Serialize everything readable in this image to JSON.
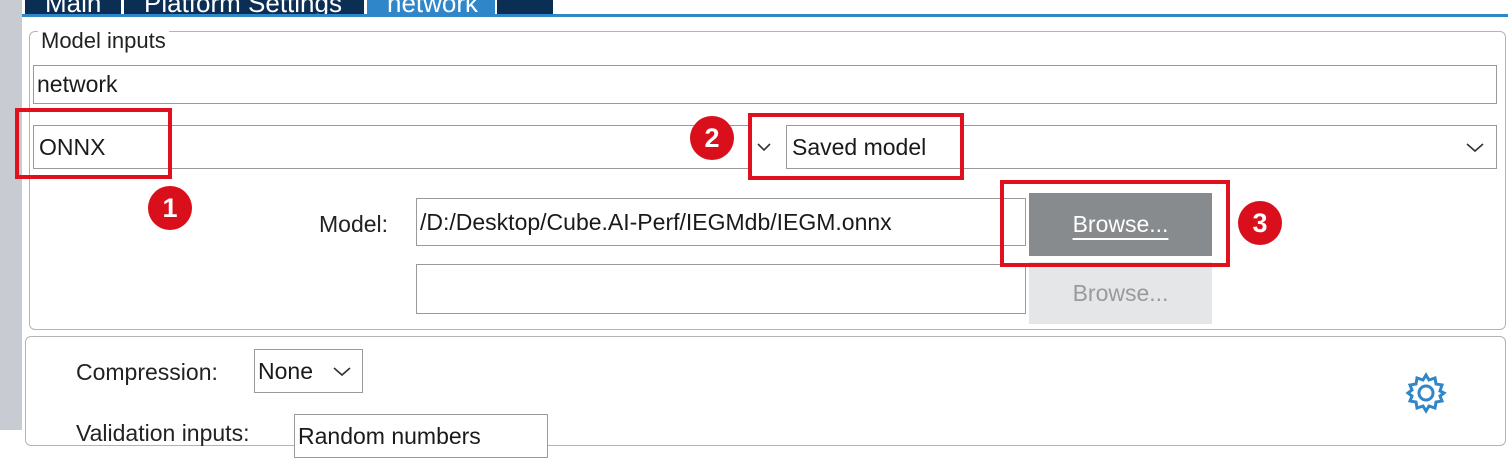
{
  "tabs": [
    {
      "label": "Main"
    },
    {
      "label": "Platform Settings"
    },
    {
      "label": "network"
    }
  ],
  "model_inputs": {
    "legend": "Model inputs",
    "name_value": "network",
    "framework_value": "ONNX",
    "model_type_value": "Saved model",
    "model_label": "Model:",
    "model_path": "/D:/Desktop/Cube.AI-Perf/IEGMdb/IEGM.onnx",
    "second_path": "",
    "browse_label": "Browse...",
    "browse_label_disabled": "Browse..."
  },
  "annotations": {
    "badge1": "1",
    "badge2": "2",
    "badge3": "3",
    "accent": "#e0101c"
  },
  "settings": {
    "compression_label": "Compression:",
    "compression_value": "None",
    "validation_label": "Validation inputs:",
    "validation_value": "Random numbers",
    "gear_icon": "gear-icon"
  },
  "colors": {
    "tab_bg": "#0b2e55",
    "tab_active": "#2f86c8",
    "browse_bg": "#888b8e"
  }
}
